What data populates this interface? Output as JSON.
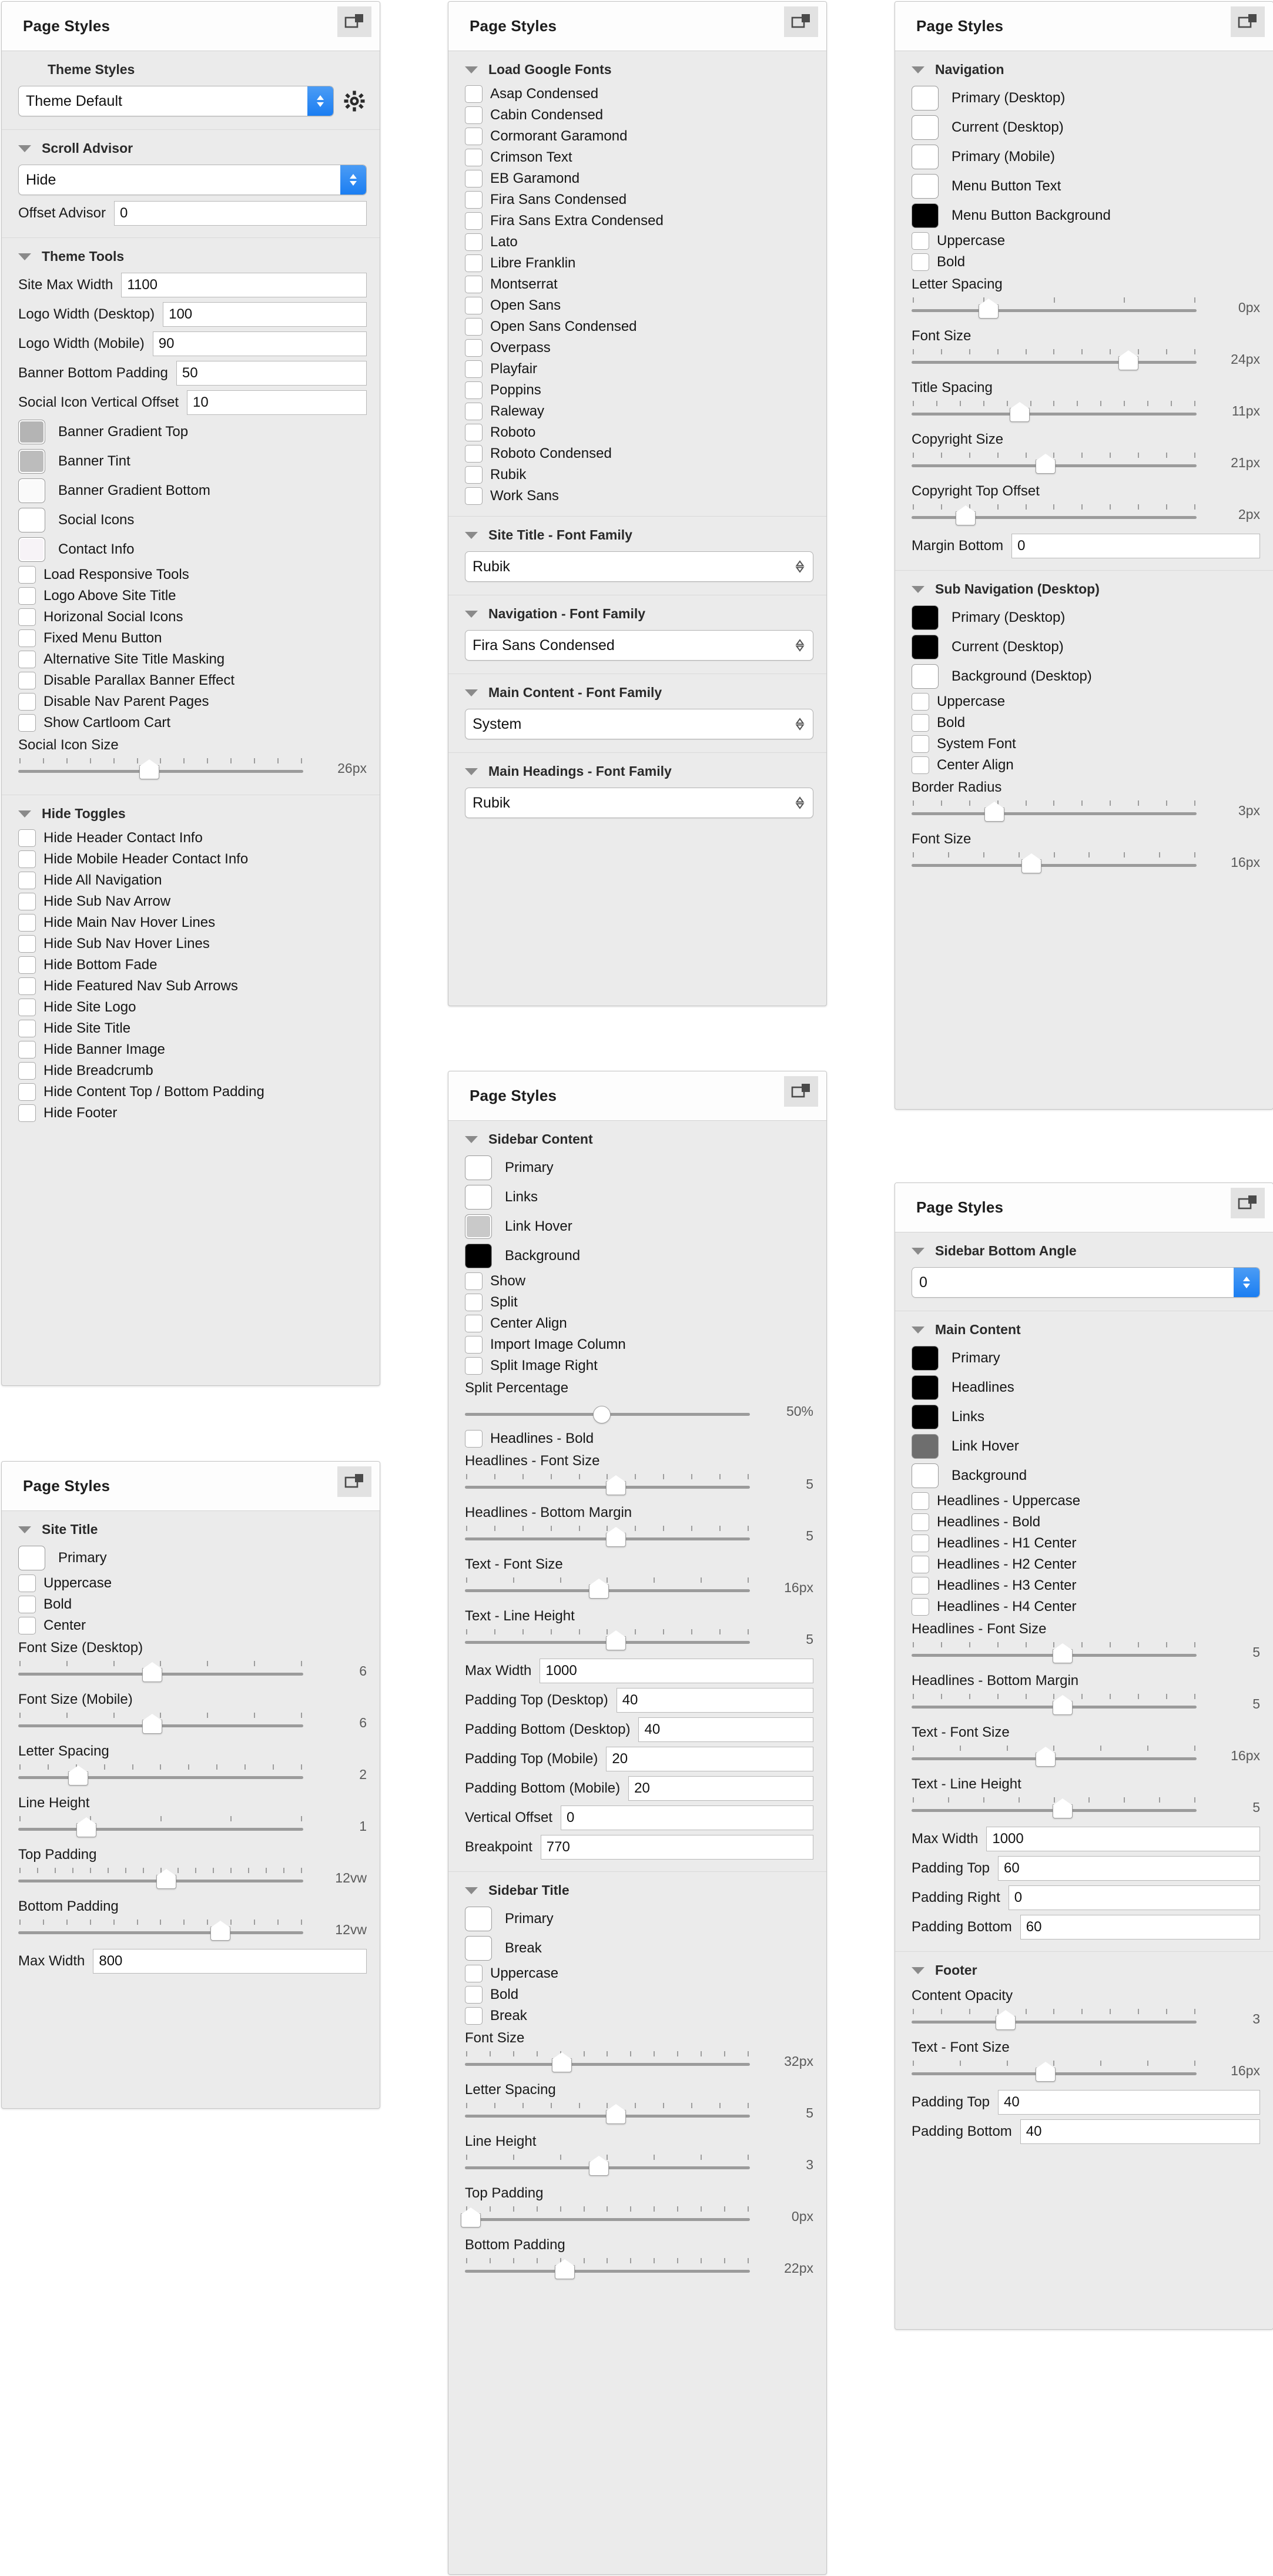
{
  "panel_title": "Page Styles",
  "panel1": {
    "theme_styles": {
      "title": "Theme Styles",
      "select_value": "Theme Default"
    },
    "scroll_advisor": {
      "title": "Scroll Advisor",
      "select_value": "Hide",
      "offset_label": "Offset Advisor",
      "offset_value": "0"
    },
    "theme_tools": {
      "title": "Theme Tools",
      "fields": [
        {
          "label": "Site Max Width",
          "value": "1100"
        },
        {
          "label": "Logo Width (Desktop)",
          "value": "100"
        },
        {
          "label": "Logo Width (Mobile)",
          "value": "90"
        },
        {
          "label": "Banner Bottom Padding",
          "value": "50"
        },
        {
          "label": "Social Icon Vertical Offset",
          "value": "10"
        }
      ],
      "swatches": [
        {
          "label": "Banner Gradient Top",
          "color": "#b4b4b4"
        },
        {
          "label": "Banner Tint",
          "color": "#bcbcbc"
        },
        {
          "label": "Banner Gradient Bottom",
          "color": "#fafafa"
        },
        {
          "label": "Social Icons",
          "color": "#ffffff"
        },
        {
          "label": "Contact Info",
          "color": "#f7f3f7"
        }
      ],
      "checkboxes": [
        "Load Responsive Tools",
        "Logo Above Site Title",
        "Horizonal Social Icons",
        "Fixed Menu Button",
        "Alternative Site Title Masking",
        "Disable Parallax Banner Effect",
        "Disable Nav Parent Pages",
        "Show Cartloom Cart"
      ],
      "slider": {
        "label": "Social Icon Size",
        "value": "26px",
        "pct": 46,
        "ticks": 13
      }
    },
    "hide_toggles": {
      "title": "Hide Toggles",
      "checkboxes": [
        "Hide Header Contact Info",
        "Hide Mobile Header Contact Info",
        "Hide All Navigation",
        "Hide Sub Nav Arrow",
        "Hide Main Nav Hover Lines",
        "Hide Sub Nav Hover Lines",
        "Hide Bottom Fade",
        "Hide Featured Nav Sub Arrows",
        "Hide Site Logo",
        "Hide Site Title",
        "Hide Banner Image",
        "Hide Breadcrumb",
        "Hide Content Top / Bottom Padding",
        "Hide Footer"
      ]
    }
  },
  "panel2": {
    "site_title": {
      "title": "Site Title",
      "swatches": [
        {
          "label": "Primary",
          "color": "#ffffff"
        }
      ],
      "checkboxes": [
        "Uppercase",
        "Bold",
        "Center"
      ],
      "sliders": [
        {
          "label": "Font Size (Desktop)",
          "value": "6",
          "pct": 47,
          "ticks": 7
        },
        {
          "label": "Font Size (Mobile)",
          "value": "6",
          "pct": 47,
          "ticks": 7
        },
        {
          "label": "Letter Spacing",
          "value": "2",
          "pct": 21,
          "ticks": 11
        },
        {
          "label": "Line Height",
          "value": "1",
          "pct": 24,
          "ticks": 5
        },
        {
          "label": "Top Padding",
          "value": "12vw",
          "pct": 52,
          "ticks": 17
        },
        {
          "label": "Bottom Padding",
          "value": "12vw",
          "pct": 71,
          "ticks": 13
        }
      ],
      "field": {
        "label": "Max Width",
        "value": "800"
      }
    }
  },
  "panel3": {
    "load_google_fonts": {
      "title": "Load Google Fonts",
      "fonts": [
        "Asap Condensed",
        "Cabin Condensed",
        "Cormorant Garamond",
        "Crimson Text",
        "EB Garamond",
        "Fira Sans Condensed",
        "Fira Sans Extra Condensed",
        "Lato",
        "Libre Franklin",
        "Montserrat",
        "Open Sans",
        "Open Sans Condensed",
        "Overpass",
        "Playfair",
        "Poppins",
        "Raleway",
        "Roboto",
        "Roboto Condensed",
        "Rubik",
        "Work Sans"
      ]
    },
    "font_families": [
      {
        "title": "Site Title - Font Family",
        "value": "Rubik"
      },
      {
        "title": "Navigation - Font Family",
        "value": "Fira Sans Condensed"
      },
      {
        "title": "Main Content - Font Family",
        "value": "System"
      },
      {
        "title": "Main Headings - Font Family",
        "value": "Rubik"
      }
    ]
  },
  "panel4": {
    "sidebar_content": {
      "title": "Sidebar Content",
      "swatches": [
        {
          "label": "Primary",
          "color": "#ffffff"
        },
        {
          "label": "Links",
          "color": "#ffffff"
        },
        {
          "label": "Link Hover",
          "color": "#c9c9c9"
        },
        {
          "label": "Background",
          "color": "#000000"
        }
      ],
      "checkboxes": [
        "Show",
        "Split",
        "Center Align",
        "Import Image Column",
        "Split Image Right"
      ],
      "split_slider": {
        "label": "Split Percentage",
        "value": "50%",
        "pct": 48,
        "ticks": 0
      },
      "headlines_bold": "Headlines - Bold",
      "sliders": [
        {
          "label": "Headlines - Font Size",
          "value": "5",
          "pct": 53,
          "ticks": 11
        },
        {
          "label": "Headlines - Bottom Margin",
          "value": "5",
          "pct": 53,
          "ticks": 11
        },
        {
          "label": "Text - Font Size",
          "value": "16px",
          "pct": 47,
          "ticks": 7
        },
        {
          "label": "Text - Line Height",
          "value": "5",
          "pct": 53,
          "ticks": 11
        }
      ],
      "fields": [
        {
          "label": "Max Width",
          "value": "1000"
        },
        {
          "label": "Padding Top (Desktop)",
          "value": "40"
        },
        {
          "label": "Padding Bottom (Desktop)",
          "value": "40"
        },
        {
          "label": "Padding Top (Mobile)",
          "value": "20"
        },
        {
          "label": "Padding Bottom (Mobile)",
          "value": "20"
        },
        {
          "label": "Vertical Offset",
          "value": "0"
        },
        {
          "label": "Breakpoint",
          "value": "770"
        }
      ]
    },
    "sidebar_title": {
      "title": "Sidebar Title",
      "swatches": [
        {
          "label": "Primary",
          "color": "#ffffff"
        },
        {
          "label": "Break",
          "color": "#ffffff"
        }
      ],
      "checkboxes": [
        "Uppercase",
        "Bold",
        "Break"
      ],
      "sliders": [
        {
          "label": "Font Size",
          "value": "32px",
          "pct": 34,
          "ticks": 13
        },
        {
          "label": "Letter Spacing",
          "value": "5",
          "pct": 53,
          "ticks": 11
        },
        {
          "label": "Line Height",
          "value": "3",
          "pct": 47,
          "ticks": 7
        },
        {
          "label": "Top Padding",
          "value": "0px",
          "pct": 2,
          "ticks": 13
        },
        {
          "label": "Bottom Padding",
          "value": "22px",
          "pct": 35,
          "ticks": 13
        }
      ]
    }
  },
  "panel5": {
    "navigation": {
      "title": "Navigation",
      "swatches": [
        {
          "label": "Primary (Desktop)",
          "color": "#ffffff"
        },
        {
          "label": "Current (Desktop)",
          "color": "#ffffff"
        },
        {
          "label": "Primary (Mobile)",
          "color": "#ffffff"
        },
        {
          "label": "Menu Button Text",
          "color": "#ffffff"
        },
        {
          "label": "Menu Button Background",
          "color": "#000000"
        }
      ],
      "checkboxes": [
        "Uppercase",
        "Bold"
      ],
      "sliders": [
        {
          "label": "Letter Spacing",
          "value": "0px",
          "pct": 27,
          "ticks": 5
        },
        {
          "label": "Font Size",
          "value": "24px",
          "pct": 76,
          "ticks": 11
        },
        {
          "label": "Title Spacing",
          "value": "11px",
          "pct": 38,
          "ticks": 13
        },
        {
          "label": "Copyright Size",
          "value": "21px",
          "pct": 47,
          "ticks": 11
        },
        {
          "label": "Copyright Top Offset",
          "value": "2px",
          "pct": 19,
          "ticks": 11
        }
      ],
      "field": {
        "label": "Margin Bottom",
        "value": "0"
      }
    },
    "sub_navigation": {
      "title": "Sub Navigation (Desktop)",
      "swatches": [
        {
          "label": "Primary (Desktop)",
          "color": "#000000"
        },
        {
          "label": "Current (Desktop)",
          "color": "#000000"
        },
        {
          "label": "Background (Desktop)",
          "color": "#ffffff"
        }
      ],
      "checkboxes": [
        "Uppercase",
        "Bold",
        "System Font",
        "Center Align"
      ],
      "sliders": [
        {
          "label": "Border Radius",
          "value": "3px",
          "pct": 29,
          "ticks": 11
        },
        {
          "label": "Font Size",
          "value": "16px",
          "pct": 42,
          "ticks": 9
        }
      ]
    }
  },
  "panel6": {
    "sidebar_bottom_angle": {
      "title": "Sidebar Bottom Angle",
      "select_value": "0"
    },
    "main_content": {
      "title": "Main Content",
      "swatches": [
        {
          "label": "Primary",
          "color": "#000000"
        },
        {
          "label": "Headlines",
          "color": "#000000"
        },
        {
          "label": "Links",
          "color": "#000000"
        },
        {
          "label": "Link Hover",
          "color": "#6e6e6e"
        },
        {
          "label": "Background",
          "color": "#ffffff"
        }
      ],
      "checkboxes": [
        "Headlines - Uppercase",
        "Headlines - Bold",
        "Headlines - H1 Center",
        "Headlines - H2 Center",
        "Headlines - H3 Center",
        "Headlines - H4 Center"
      ],
      "sliders": [
        {
          "label": "Headlines - Font Size",
          "value": "5",
          "pct": 53,
          "ticks": 11
        },
        {
          "label": "Headlines - Bottom Margin",
          "value": "5",
          "pct": 53,
          "ticks": 11
        },
        {
          "label": "Text - Font Size",
          "value": "16px",
          "pct": 47,
          "ticks": 7
        },
        {
          "label": "Text - Line Height",
          "value": "5",
          "pct": 53,
          "ticks": 9
        }
      ],
      "fields": [
        {
          "label": "Max Width",
          "value": "1000"
        },
        {
          "label": "Padding Top",
          "value": "60"
        },
        {
          "label": "Padding Right",
          "value": "0"
        },
        {
          "label": "Padding Bottom",
          "value": "60"
        }
      ]
    },
    "footer": {
      "title": "Footer",
      "sliders": [
        {
          "label": "Content Opacity",
          "value": "3",
          "pct": 33,
          "ticks": 11
        },
        {
          "label": "Text - Font Size",
          "value": "16px",
          "pct": 47,
          "ticks": 7
        }
      ],
      "fields": [
        {
          "label": "Padding Top",
          "value": "40"
        },
        {
          "label": "Padding Bottom",
          "value": "40"
        }
      ]
    }
  }
}
